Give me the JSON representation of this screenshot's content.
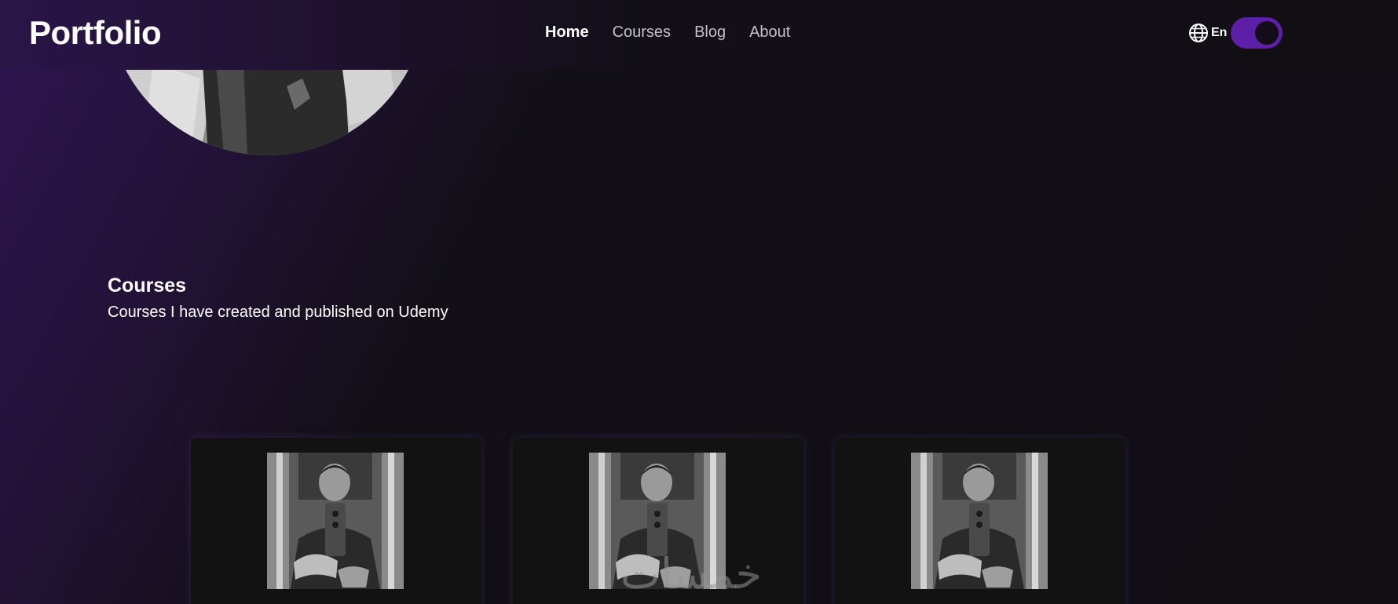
{
  "header": {
    "brand": "Portfolio",
    "nav": [
      {
        "label": "Home",
        "active": true
      },
      {
        "label": "Courses",
        "active": false
      },
      {
        "label": "Blog",
        "active": false
      },
      {
        "label": "About",
        "active": false
      }
    ],
    "language": {
      "code": "En",
      "icon": "globe-icon"
    },
    "theme_toggle": {
      "on": true,
      "color": "#5b1fa8"
    }
  },
  "courses_section": {
    "title": "Courses",
    "subtitle": "Courses I have created and published on Udemy",
    "cards": [
      {
        "thumbnail": "profile-photo"
      },
      {
        "thumbnail": "profile-photo"
      },
      {
        "thumbnail": "profile-photo"
      }
    ]
  },
  "watermark": {
    "text": "خمسات"
  },
  "colors": {
    "accent": "#5b1fa8",
    "background": "#110e14",
    "gradient": "#2e1550",
    "card": "#121212"
  }
}
